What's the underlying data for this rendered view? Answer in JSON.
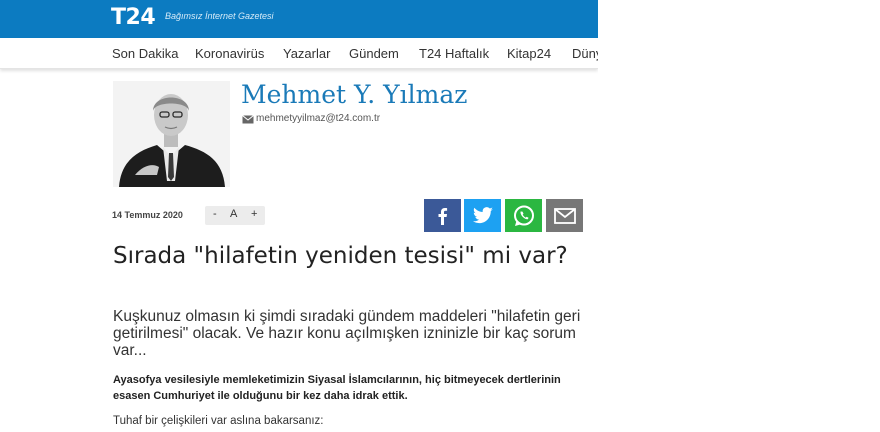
{
  "header": {
    "logo": "T24",
    "tagline": "Bağımsız İnternet Gazetesi"
  },
  "nav": {
    "items": [
      {
        "label": "Son Dakika"
      },
      {
        "label": "Koronavirüs"
      },
      {
        "label": "Yazarlar"
      },
      {
        "label": "Gündem"
      },
      {
        "label": "T24 Haftalık"
      },
      {
        "label": "Kitap24"
      },
      {
        "label": "Düny"
      }
    ]
  },
  "author": {
    "name": "Mehmet Y. Yılmaz",
    "email": "mehmetyyilmaz@t24.com.tr",
    "mail_icon": "envelope-icon"
  },
  "article": {
    "date": "14 Temmuz 2020",
    "font_controls": {
      "decrease": "-",
      "label": "A",
      "increase": "+"
    },
    "headline": "Sırada \"hilafetin yeniden tesisi\" mi var?",
    "lead": "Kuşkunuz olmasın ki şimdi sıradaki gündem maddeleri \"hilafetin geri getirilmesi\" olacak. Ve hazır konu açılmışken izninizle bir kaç sorum var...",
    "bold_paragraph": "Ayasofya vesilesiyle memleketimizin Siyasal İslamcılarının, hiç bitmeyecek dertlerinin esasen Cumhuriyet ile olduğunu bir kez daha idrak ettik.",
    "paragraph": "Tuhaf bir çelişkileri var aslına bakarsanız:"
  },
  "share": {
    "facebook": {
      "icon": "facebook-icon",
      "color": "#3b5998"
    },
    "twitter": {
      "icon": "twitter-icon",
      "color": "#1da1f2"
    },
    "whatsapp": {
      "icon": "whatsapp-icon",
      "color": "#2bb741"
    },
    "email": {
      "icon": "mail-icon",
      "color": "#777777"
    }
  },
  "colors": {
    "brand": "#0c7bc1",
    "author_name": "#1a7ab8"
  }
}
